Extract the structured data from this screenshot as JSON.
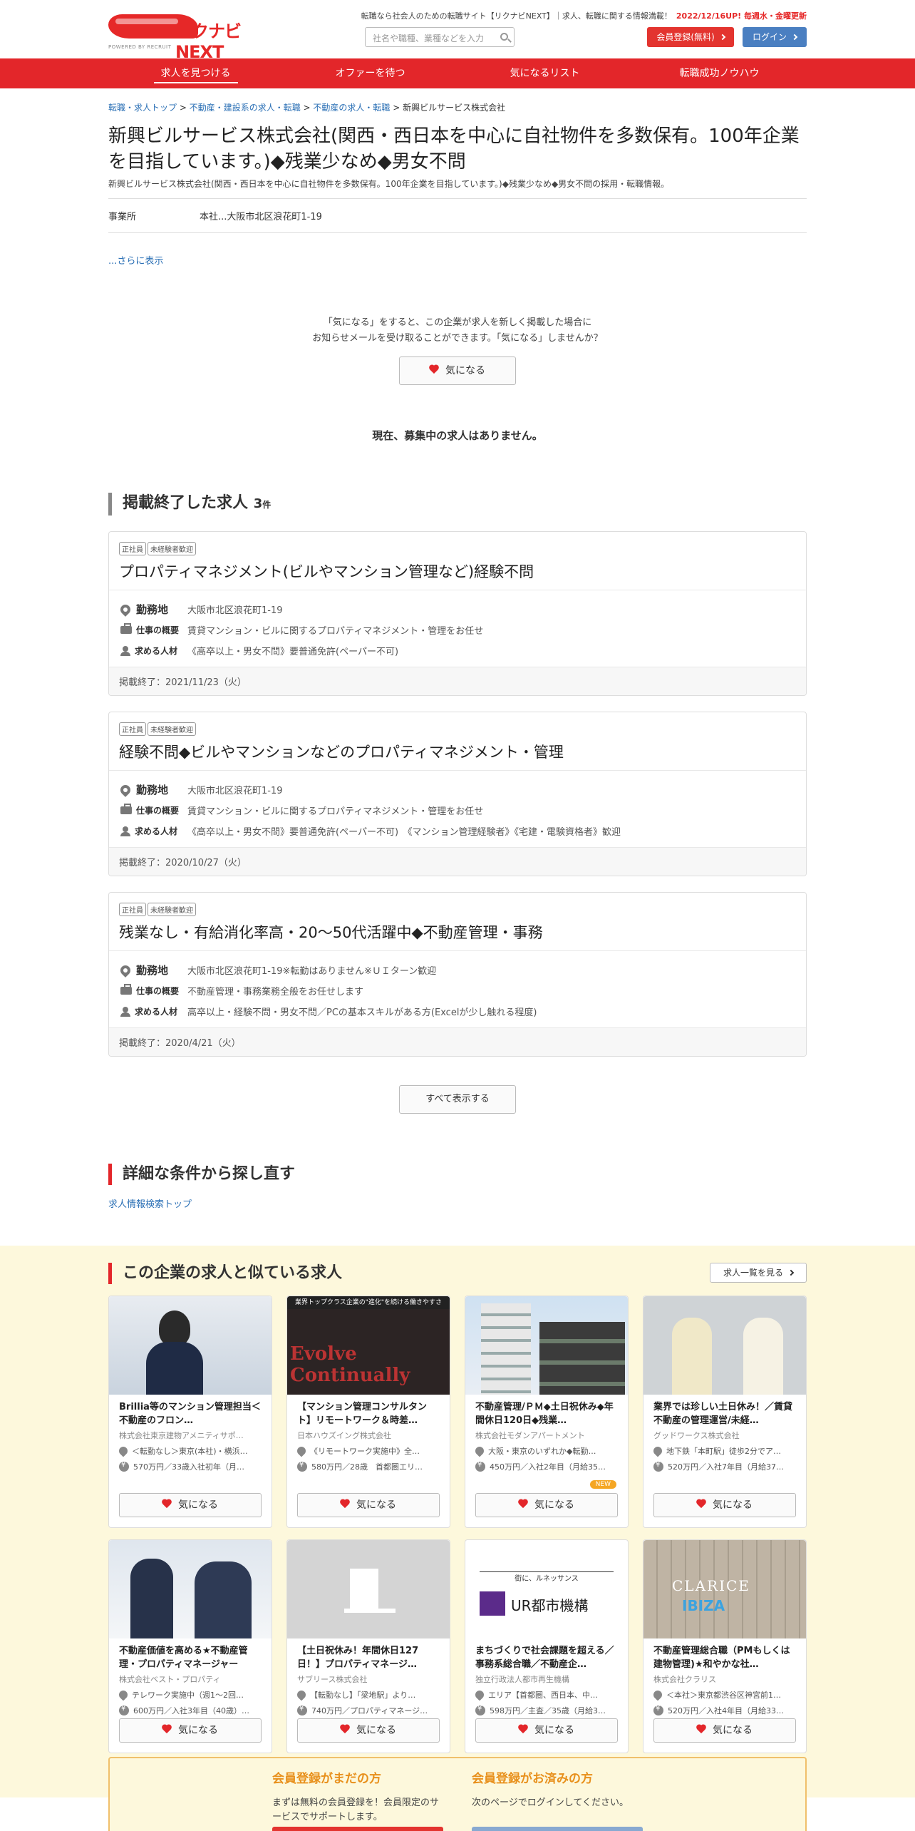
{
  "header": {
    "logo_text": "リクナビNEXT",
    "powered": "POWERED BY RECRUIT",
    "tagline": "転職なら社会人のための転職サイト【リクナビNEXT】｜求人、転職に関する情報満載！",
    "update": "2022/12/16UP! 毎週水・金曜更新",
    "search_placeholder": "社名や職種、業種などを入力",
    "register_label": "会員登録(無料)",
    "login_label": "ログイン"
  },
  "nav": [
    "求人を見つける",
    "オファーを待つ",
    "気になるリスト",
    "転職成功ノウハウ"
  ],
  "breadcrumb": [
    "転職・求人トップ",
    "不動産・建設系の求人・転職",
    "不動産の求人・転職",
    "新興ビルサービス株式会社"
  ],
  "company": {
    "title": "新興ビルサービス株式会社(関西・西日本を中心に自社物件を多数保有。100年企業を目指しています。)◆残業少なめ◆男女不問",
    "desc": "新興ビルサービス株式会社(関西・西日本を中心に自社物件を多数保有。100年企業を目指しています。)◆残業少なめ◆男女不問の採用・転職情報。",
    "office_label": "事業所",
    "office_value": "本社...大阪市北区浪花町1-19",
    "more": "...さらに表示"
  },
  "kininaru": {
    "note1": "「気になる」をすると、この企業が求人を新しく掲載した場合に",
    "note2": "お知らせメールを受け取ることができます。「気になる」しませんか？",
    "button": "気になる"
  },
  "no_jobs": "現在、募集中の求人はありません。",
  "ended": {
    "title": "掲載終了した求人",
    "count": "3",
    "unit": "件",
    "labels": {
      "location": "勤務地",
      "work": "仕事の概要",
      "person": "求める人材"
    },
    "jobs": [
      {
        "tags": [
          "正社員",
          "未経験者歓迎"
        ],
        "title": "プロパティマネジメント(ビルやマンション管理など)経験不問",
        "location": "大阪市北区浪花町1-19",
        "work": "賃貸マンション・ビルに関するプロパティマネジメント・管理をお任せ",
        "person": "《高卒以上・男女不問》要普通免許(ペーパー不可)",
        "ended": "掲載終了：2021/11/23（火）"
      },
      {
        "tags": [
          "正社員",
          "未経験者歓迎"
        ],
        "title": "経験不問◆ビルやマンションなどのプロパティマネジメント・管理",
        "location": "大阪市北区浪花町1-19",
        "work": "賃貸マンション・ビルに関するプロパティマネジメント・管理をお任せ",
        "person": "《高卒以上・男女不問》要普通免許(ペーパー不可)　《マンション管理経験者》《宅建・電験資格者》歓迎",
        "ended": "掲載終了：2020/10/27（火）"
      },
      {
        "tags": [
          "正社員",
          "未経験者歓迎"
        ],
        "title": "残業なし・有給消化率高・20～50代活躍中◆不動産管理・事務",
        "location": "大阪市北区浪花町1-19※転勤はありません※ＵＩターン歓迎",
        "work": "不動産管理・事務業務全般をお任せします",
        "person": "高卒以上・経験不問・男女不問／PCの基本スキルがある方(Excelが少し触れる程度)",
        "ended": "掲載終了：2020/4/21（火）"
      }
    ],
    "show_all": "すべて表示する"
  },
  "research": {
    "title": "詳細な条件から探し直す",
    "link": "求人情報検索トップ"
  },
  "similar": {
    "title": "この企業の求人と似ている求人",
    "list_button": "求人一覧を見る",
    "button": "気になる",
    "new_badge": "NEW",
    "img_texts": {
      "p2_bar": "業界トップクラス企業の\"進化\"を続ける働きやすさ",
      "p2_ev": "Evolve Continually",
      "p7_rn": "街に、ルネッサンス",
      "p7_ur": "UR都市機構",
      "p8_cl": "CLARICE",
      "p8_ib": "IBIZA"
    },
    "jobs": [
      {
        "title": "Brillia等のマンション管理担当＜不動産のフロン…",
        "company": "株式会社東京建物アメニティサポ…",
        "loc": "＜転勤なし＞東京(本社)・横浜…",
        "pay": "570万円／33歳入社初年（月…",
        "img": "p1"
      },
      {
        "title": "【マンション管理コンサルタント】リモートワーク＆時差…",
        "company": "日本ハウズイング株式会社",
        "loc": "《リモートワーク実施中》全…",
        "pay": "580万円／28歳　首都圏エリ…",
        "img": "p2"
      },
      {
        "title": "不動産管理/ＰＭ◆土日祝休み◆年間休日120日◆残業…",
        "company": "株式会社モダンアパートメント",
        "loc": "大阪・東京のいずれか◆転勤…",
        "pay": "450万円／入社2年目（月給35…",
        "img": "p3"
      },
      {
        "title": "業界では珍しい土日休み！／賃貸不動産の管理運営/未経…",
        "company": "グッドワークス株式会社",
        "loc": "地下鉄「本町駅」徒歩2分でア…",
        "pay": "520万円／入社7年目（月給37…",
        "img": "p4"
      },
      {
        "title": "不動産価値を高める★不動産管理・プロパティマネージャー",
        "company": "株式会社ベスト・プロパティ",
        "loc": "テレワーク実施中（週1～2回…",
        "pay": "600万円／入社3年目（40歳）…",
        "img": "p5"
      },
      {
        "title": "【土日祝休み！年間休日127日！】プロパティマネージ…",
        "company": "サブリース株式会社",
        "loc": "【転勤なし】「梁地駅」より…",
        "pay": "740万円／プロパティマネージ…",
        "img": "p6"
      },
      {
        "title": "まちづくりで社会課題を超える／事務系総合職／不動産企…",
        "company": "独立行政法人都市再生機構",
        "loc": "エリア【首都圏、西日本、中…",
        "pay": "598万円／主査／35歳（月給3…",
        "img": "p7"
      },
      {
        "title": "不動産管理総合職（PMもしくは建物管理)★和やかな社…",
        "company": "株式会社クラリス",
        "loc": "＜本社＞東京都渋谷区神宮前1…",
        "pay": "520万円／入社4年目（月給33…",
        "img": "p8"
      }
    ]
  },
  "bottom": {
    "left_title": "会員登録がまだの方",
    "left_text": "まずは無料の会員登録を！会員限定のサービスでサポートします。",
    "right_title": "会員登録がお済みの方",
    "right_text": "次のページでログインしてください。"
  }
}
